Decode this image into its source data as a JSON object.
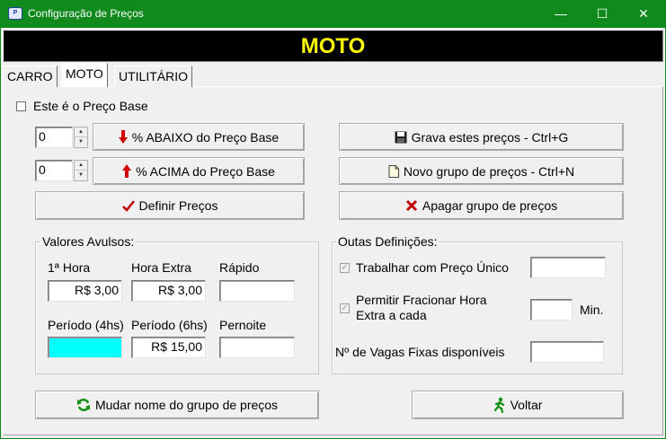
{
  "window": {
    "title": "Configuração de Preços",
    "minimize": "—",
    "maximize": "☐",
    "close": "✕"
  },
  "banner": {
    "text": "MOTO"
  },
  "tabs": [
    {
      "label": "CARRO"
    },
    {
      "label": "MOTO",
      "active": true
    },
    {
      "label": "UTILITÁRIO"
    }
  ],
  "base_price": {
    "label": "Este é o Preço Base",
    "checked": false
  },
  "adjust": {
    "below_value": "0",
    "above_value": "0",
    "below_button": "% ABAIXO do Preço Base",
    "above_button": "% ACIMA do Preço Base",
    "define_button": "Definir Preços"
  },
  "actions": {
    "save_button": "Grava estes preços - Ctrl+G",
    "new_group_button": "Novo grupo de preços - Ctrl+N",
    "delete_group_button": "Apagar grupo de preços",
    "rename_group_button": "Mudar nome do grupo de preços",
    "back_button": "Voltar"
  },
  "valores": {
    "title": "Valores Avulsos:",
    "first_hour_label": "1ª Hora",
    "first_hour_value": "R$  3,00",
    "extra_hour_label": "Hora Extra",
    "extra_hour_value": "R$  3,00",
    "quick_label": "Rápido",
    "quick_value": "",
    "period4_label": "Período (4hs)",
    "period4_value": "",
    "period6_label": "Período (6hs)",
    "period6_value": "R$  15,00",
    "overnight_label": "Pernoite",
    "overnight_value": ""
  },
  "outras": {
    "title": "Outas Definições:",
    "single_price_label": "Trabalhar com Preço Único",
    "single_price_checked": true,
    "single_price_value": "",
    "fraction_label_line1": "Permitir Fracionar Hora",
    "fraction_label_line2": "Extra a cada",
    "fraction_checked": true,
    "fraction_value": "",
    "fraction_unit": "Min.",
    "spots_label": "Nº de Vagas Fixas disponíveis",
    "spots_value": ""
  },
  "colors": {
    "titlebar": "#10891d",
    "banner_bg": "#000000",
    "banner_text": "#ffff00",
    "period4_field": "#00ffff"
  }
}
